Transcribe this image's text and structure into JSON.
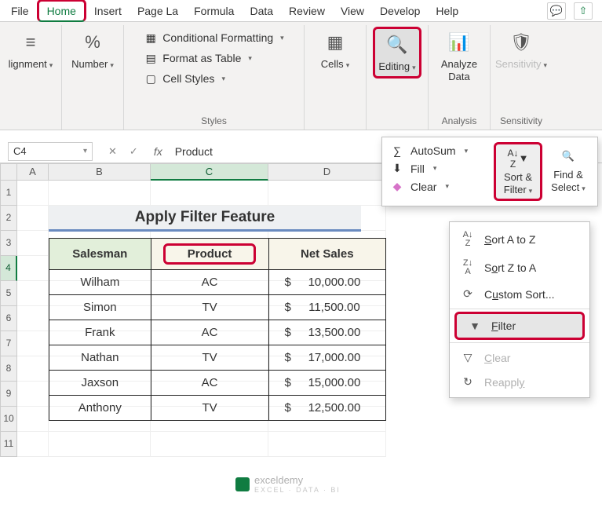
{
  "ribbon": {
    "tabs": [
      "File",
      "Home",
      "Insert",
      "Page La",
      "Formula",
      "Data",
      "Review",
      "View",
      "Develop",
      "Help"
    ],
    "active_tab": "Home",
    "groups": {
      "alignment": {
        "label": "lignment"
      },
      "number": {
        "label": "Number"
      },
      "styles": {
        "label": "Styles",
        "conditional": "Conditional Formatting",
        "table": "Format as Table",
        "cellstyles": "Cell Styles"
      },
      "cells": {
        "label": "Cells"
      },
      "editing": {
        "label": "Editing"
      },
      "analysis": {
        "label": "Analysis",
        "btn": "Analyze Data"
      },
      "sensitivity": {
        "label": "Sensitivity",
        "btn": "Sensitivity"
      }
    }
  },
  "editing_panel": {
    "autosum": "AutoSum",
    "fill": "Fill",
    "clear": "Clear",
    "sortfilter": "Sort & Filter",
    "findselect": "Find & Select"
  },
  "sort_menu": {
    "sort_az": "Sort A to Z",
    "sort_za": "Sort Z to A",
    "custom": "Custom Sort...",
    "filter": "Filter",
    "clear": "Clear",
    "reapply": "Reapply"
  },
  "formula_bar": {
    "name_box": "C4",
    "value": "Product"
  },
  "sheet": {
    "title": "Apply Filter Feature",
    "headers": {
      "salesman": "Salesman",
      "product": "Product",
      "netsales": "Net Sales"
    },
    "rows": [
      {
        "salesman": "Wilham",
        "product": "AC",
        "netsales": "10,000.00"
      },
      {
        "salesman": "Simon",
        "product": "TV",
        "netsales": "11,500.00"
      },
      {
        "salesman": "Frank",
        "product": "AC",
        "netsales": "13,500.00"
      },
      {
        "salesman": "Nathan",
        "product": "TV",
        "netsales": "17,000.00"
      },
      {
        "salesman": "Jaxson",
        "product": "AC",
        "netsales": "15,000.00"
      },
      {
        "salesman": "Anthony",
        "product": "TV",
        "netsales": "12,500.00"
      }
    ],
    "currency": "$"
  },
  "columns": [
    "A",
    "B",
    "C",
    "D"
  ],
  "row_numbers": [
    1,
    2,
    3,
    4,
    5,
    6,
    7,
    8,
    9,
    10,
    11
  ],
  "watermark": {
    "name": "exceldemy",
    "tag": "EXCEL · DATA · BI"
  }
}
